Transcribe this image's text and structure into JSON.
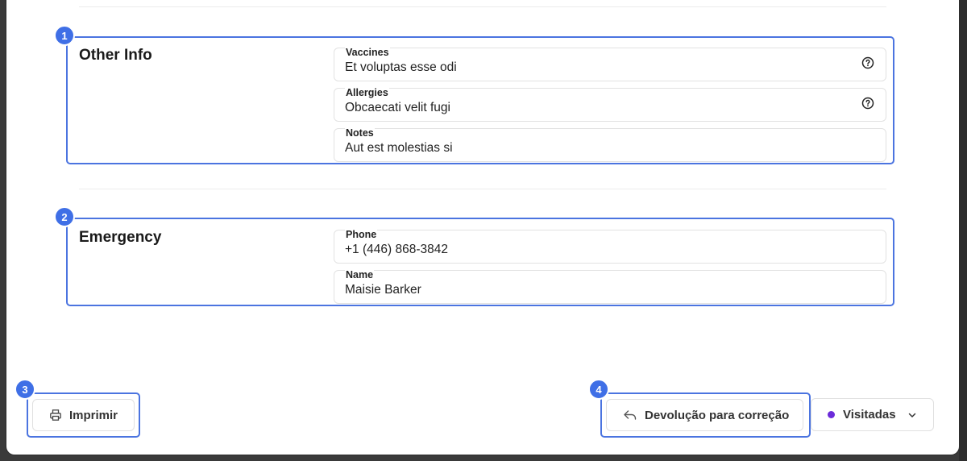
{
  "sections": {
    "other_info": {
      "title": "Other Info",
      "fields": [
        {
          "label": "Vaccines",
          "value": "Et voluptas esse odi"
        },
        {
          "label": "Allergies",
          "value": "Obcaecati velit fugi"
        },
        {
          "label": "Notes",
          "value": "Aut est molestias si"
        }
      ]
    },
    "emergency": {
      "title": "Emergency",
      "fields": [
        {
          "label": "Phone",
          "value": "+1 (446) 868-3842"
        },
        {
          "label": "Name",
          "value": "Maisie Barker"
        }
      ]
    }
  },
  "badges": [
    "1",
    "2",
    "3",
    "4"
  ],
  "footer": {
    "print_label": "Imprimir",
    "return_label": "Devolução para correção",
    "status_label": "Visitadas",
    "status_color": "#6b2bd9"
  },
  "colors": {
    "highlight": "#4b74e0",
    "badge": "#3f6fe6"
  },
  "icons": {
    "help": "question-circle-icon",
    "print": "printer-icon",
    "return": "reply-arrow-icon",
    "dropdown": "chevron-down-icon"
  }
}
